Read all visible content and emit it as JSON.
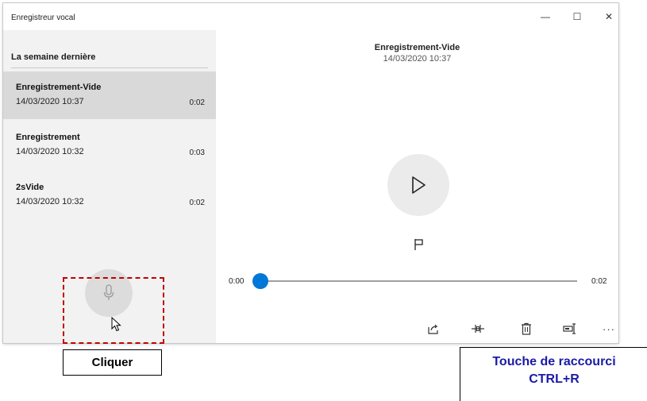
{
  "window": {
    "title": "Enregistreur vocal",
    "controls": {
      "minimize": "—",
      "maximize": "☐",
      "close": "✕"
    }
  },
  "sidebar": {
    "section_header": "La semaine dernière",
    "items": [
      {
        "name": "Enregistrement-Vide",
        "date": "14/03/2020 10:37",
        "duration": "0:02",
        "selected": true
      },
      {
        "name": "Enregistrement",
        "date": "14/03/2020 10:32",
        "duration": "0:03",
        "selected": false
      },
      {
        "name": "2sVide",
        "date": "14/03/2020 10:32",
        "duration": "0:02",
        "selected": false
      }
    ],
    "record_button_icon": "microphone-icon"
  },
  "player": {
    "name": "Enregistrement-Vide",
    "date": "14/03/2020 10:37",
    "play_icon": "play-icon",
    "flag_icon": "flag-icon",
    "time_start": "0:00",
    "time_end": "0:02",
    "progress": 0,
    "toolbar": {
      "share_icon": "share-icon",
      "trim_icon": "trim-icon",
      "delete_icon": "trash-icon",
      "rename_icon": "rename-icon",
      "more_label": "···"
    }
  },
  "annotations": {
    "click_label": "Cliquer",
    "shortcut_line1": "Touche de raccourci",
    "shortcut_line2": "CTRL+R",
    "highlight_color": "#c00000",
    "shortcut_color": "#1a1aa6"
  },
  "colors": {
    "accent": "#0078d7",
    "sidebar_bg": "#f2f2f2",
    "selected_bg": "#d9d9d9"
  }
}
